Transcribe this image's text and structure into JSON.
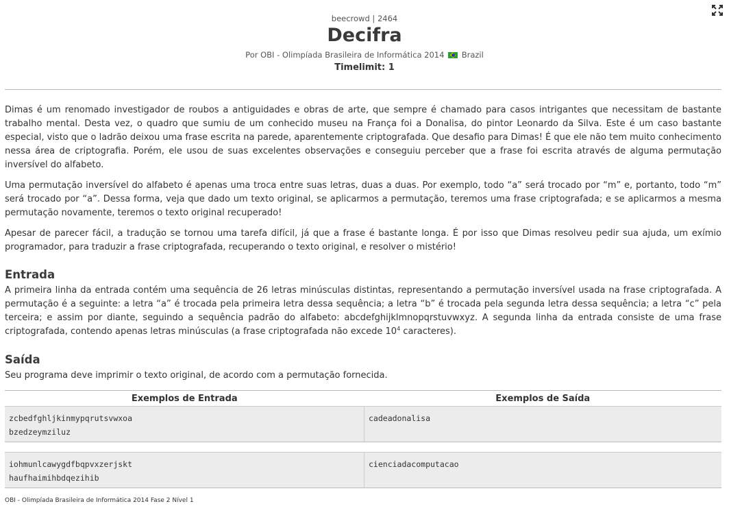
{
  "header": {
    "source": "beecrowd | 2464",
    "title": "Decifra",
    "author_prefix": "Por OBI - Olimpíada Brasileira de Informática 2014",
    "country": "Brazil",
    "timelimit": "Timelimit: 1"
  },
  "description": {
    "paragraphs": [
      "Dimas é um renomado investigador de roubos a antiguidades e obras de arte, que sempre é chamado para casos intrigantes que necessitam de bastante trabalho mental. Desta vez, o quadro que sumiu de um conhecido museu na França foi a Donalisa, do pintor Leonardo da Silva. Este é um caso bastante especial, visto que o ladrão deixou uma frase escrita na parede, aparentemente criptografada. Que desafio para Dimas! É que ele não tem muito conhecimento nessa área de criptografia. Porém, ele usou de suas excelentes observações e conseguiu perceber que a frase foi escrita através de alguma permutação inversível do alfabeto.",
      "Uma permutação inversível do alfabeto é apenas uma troca entre suas letras, duas a duas. Por exemplo, todo “a” será trocado por “m” e, portanto, todo “m” será trocado por “a”. Dessa forma, veja que dado um texto original, se aplicarmos a permutação, teremos uma frase criptografada; e se aplicarmos a mesma permutação novamente, teremos o texto original recuperado!",
      "Apesar de parecer fácil, a tradução se tornou uma tarefa difícil, já que a frase é bastante longa. É por isso que Dimas resolveu pedir sua ajuda, um exímio programador, para traduzir a frase criptografada, recuperando o texto original, e resolver o mistério!"
    ]
  },
  "input_section": {
    "heading": "Entrada",
    "text": "A primeira linha da entrada contém uma sequência de 26 letras minúsculas distintas, representando a permutação inversível usada na frase criptografada. A permutação é a seguinte: a letra “a” é trocada pela primeira letra dessa sequência; a letra “b” é trocada pela segunda letra dessa sequência; a letra “c” pela terceira; e assim por diante, seguindo a sequência padrão do alfabeto: abcdefghijklmnopqrstuvwxyz. A segunda linha da entrada consiste de uma frase criptografada, contendo apenas letras minúsculas (a frase criptografada não excede 10",
    "exponent": "4",
    "text_end": " caracteres)."
  },
  "output_section": {
    "heading": "Saída",
    "text": "Seu programa deve imprimir o texto original, de acordo com a permutação fornecida."
  },
  "examples": {
    "input_header": "Exemplos de Entrada",
    "output_header": "Exemplos de Saída",
    "rows": [
      {
        "input_line1": "zcbedfghljkinmypqrutsvwxoa",
        "input_line2": "bzedzeymziluz",
        "output": "cadeadonalisa"
      },
      {
        "input_line1": "iohmunlcawygdfbqpvxzerjskt",
        "input_line2": "haufhaimihbdqezihib",
        "output": "cienciadacomputacao"
      }
    ]
  },
  "footer": {
    "text": "OBI - Olimpíada Brasileira de Informática 2014 Fase 2 Nível 1"
  },
  "icons": {
    "expand": "expand-icon",
    "flag": "brazil-flag-icon"
  }
}
